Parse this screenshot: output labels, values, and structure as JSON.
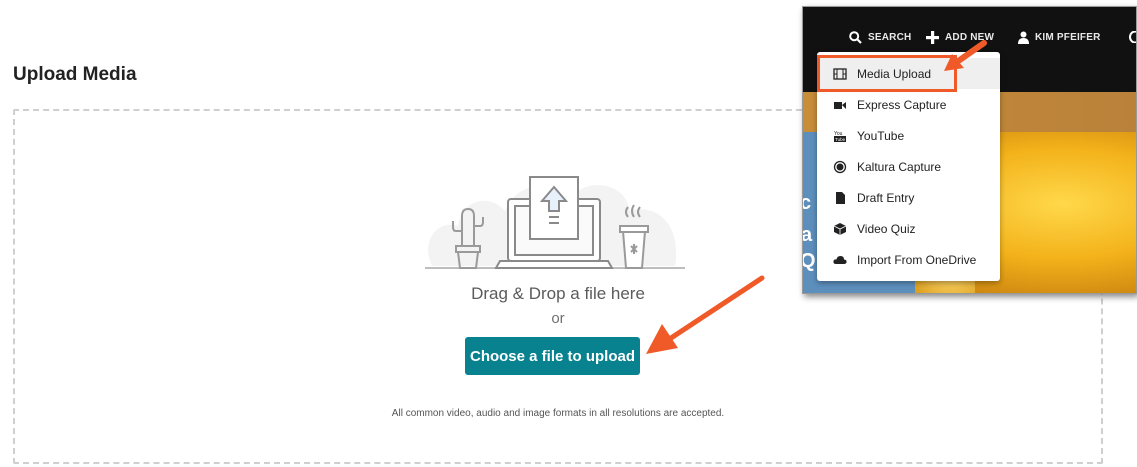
{
  "page": {
    "title": "Upload Media"
  },
  "upload": {
    "drag_text": "Drag & Drop a file here",
    "or_text": "or",
    "choose_label": "Choose a file to upload",
    "formats_text": "All common video, audio and image formats in all resolutions are accepted."
  },
  "nav": {
    "search": "SEARCH",
    "add_new": "ADD NEW",
    "user": "KIM PFEIFER"
  },
  "menu": {
    "items": [
      {
        "label": "Media Upload",
        "icon": "film-icon"
      },
      {
        "label": "Express Capture",
        "icon": "video-camera-icon"
      },
      {
        "label": "YouTube",
        "icon": "youtube-icon"
      },
      {
        "label": "Kaltura Capture",
        "icon": "record-icon"
      },
      {
        "label": "Draft Entry",
        "icon": "file-icon"
      },
      {
        "label": "Video Quiz",
        "icon": "cube-icon"
      },
      {
        "label": "Import From OneDrive",
        "icon": "cloud-icon"
      }
    ]
  },
  "hero": {
    "letters": [
      "c",
      "a",
      "Q"
    ]
  },
  "colors": {
    "button": "#09828f",
    "annotation": "#f05a28",
    "topbar": "#111111"
  }
}
